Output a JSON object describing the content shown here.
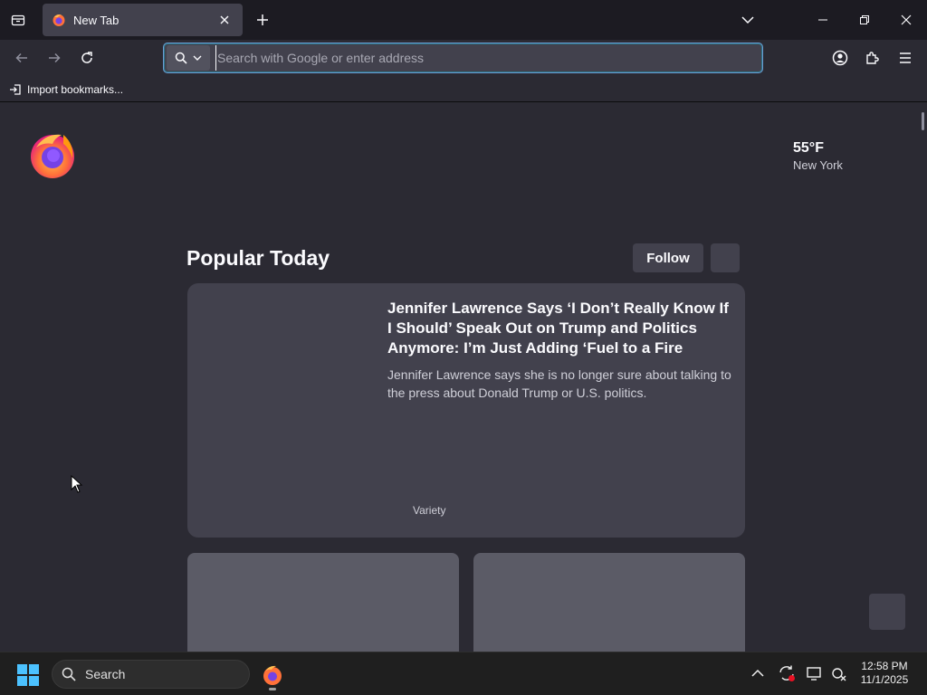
{
  "browser": {
    "tab": {
      "title": "New Tab"
    },
    "urlbar": {
      "placeholder": "Search with Google or enter address"
    },
    "bookmarks": {
      "import_label": "Import bookmarks..."
    }
  },
  "newtab": {
    "weather": {
      "temperature": "55°F",
      "location": "New York"
    },
    "section": {
      "title": "Popular Today",
      "follow_label": "Follow"
    },
    "hero_story": {
      "title": "Jennifer Lawrence Says ‘I Don’t Really Know If I Should’ Speak Out on Trump and Politics Anymore: I’m Just Adding ‘Fuel to a Fire That’s…",
      "excerpt": "Jennifer Lawrence says she is no longer sure about talking to the press about Donald Trump or U.S. politics.",
      "source": "Variety"
    }
  },
  "taskbar": {
    "search_label": "Search",
    "clock": {
      "time": "12:58 PM",
      "date": "11/1/2025"
    }
  },
  "colors": {
    "page_bg": "#2b2a33",
    "card_bg": "#42414d",
    "tabstrip_bg": "#1c1b22",
    "taskbar_bg": "#1f1f1f",
    "accent_focus": "#6c9bd2"
  }
}
